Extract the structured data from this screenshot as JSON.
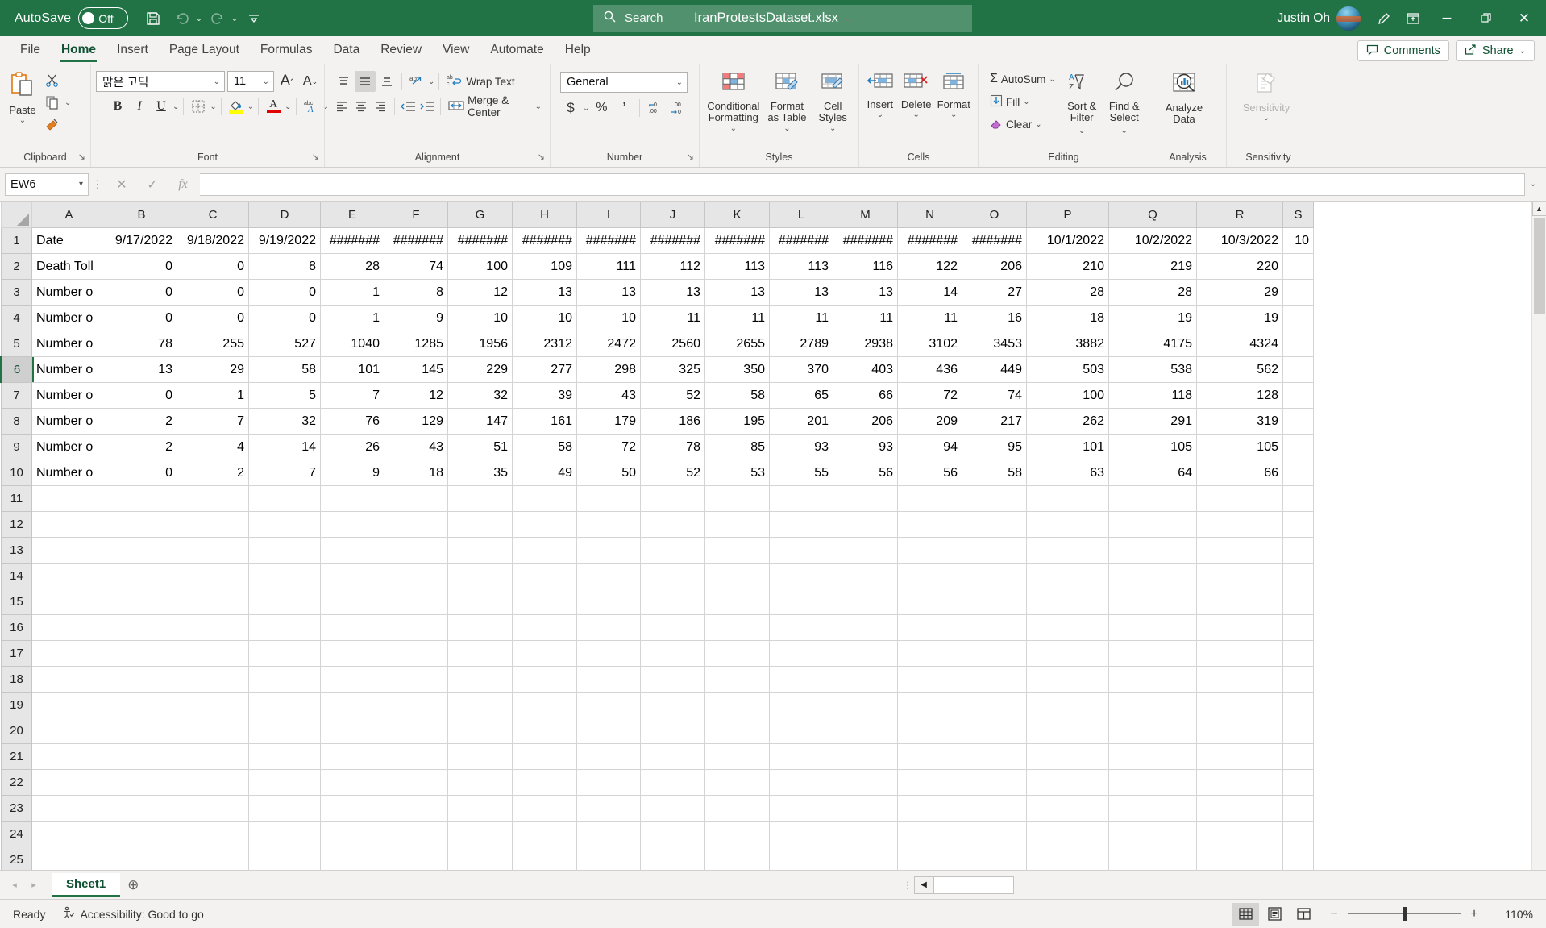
{
  "titlebar": {
    "autosave_label": "AutoSave",
    "autosave_state": "Off",
    "save_icon": "save-icon",
    "undo_icon": "undo-icon",
    "redo_icon": "redo-icon",
    "customize_icon": "customize-quick-access-icon",
    "document_title": "IranProtestsDataset.xlsx",
    "title_chevron": "⌄",
    "search_placeholder": "Search",
    "search_icon": "search-icon",
    "username": "Justin Oh",
    "avatar": "user-avatar",
    "pen_icon": "draw-pen-icon",
    "ribbon_display_icon": "ribbon-display-options-icon",
    "minimize_icon": "─",
    "restore_icon": "❐",
    "close_icon": "✕"
  },
  "tabs": [
    {
      "label": "File",
      "active": false
    },
    {
      "label": "Home",
      "active": true
    },
    {
      "label": "Insert",
      "active": false
    },
    {
      "label": "Page Layout",
      "active": false
    },
    {
      "label": "Formulas",
      "active": false
    },
    {
      "label": "Data",
      "active": false
    },
    {
      "label": "Review",
      "active": false
    },
    {
      "label": "View",
      "active": false
    },
    {
      "label": "Automate",
      "active": false
    },
    {
      "label": "Help",
      "active": false
    }
  ],
  "tab_right": {
    "comments_label": "Comments",
    "comments_icon": "comment-icon",
    "share_label": "Share",
    "share_icon": "share-icon",
    "share_chevron": "⌄"
  },
  "ribbon": {
    "clipboard": {
      "group_label": "Clipboard",
      "dialog_launcher": "↘",
      "paste_label": "Paste",
      "paste_chevron": "⌄",
      "cut_icon": "cut-scissors-icon",
      "copy_icon": "copy-icon",
      "copy_chevron": "⌄",
      "format_painter_icon": "format-painter-icon"
    },
    "font": {
      "group_label": "Font",
      "dialog_launcher": "↘",
      "font_name": "맑은 고딕",
      "font_size": "11",
      "grow_font_label": "A",
      "shrink_font_label": "A",
      "bold_label": "B",
      "italic_label": "I",
      "underline_label": "U",
      "borders_icon": "borders-icon",
      "fill_color_icon": "fill-color-icon",
      "font_color_icon": "font-color-icon",
      "phonetic_icon": "phonetic-guide-icon",
      "chevron": "⌄"
    },
    "alignment": {
      "group_label": "Alignment",
      "dialog_launcher": "↘",
      "align_top_icon": "align-top-icon",
      "align_middle_icon": "align-middle-icon",
      "align_bottom_icon": "align-bottom-icon",
      "orientation_icon": "text-orientation-icon",
      "wrap_text_label": "Wrap Text",
      "wrap_text_icon": "wrap-text-icon",
      "align_left_icon": "align-left-icon",
      "align_center_icon": "align-center-icon",
      "align_right_icon": "align-right-icon",
      "decrease_indent_icon": "decrease-indent-icon",
      "increase_indent_icon": "increase-indent-icon",
      "merge_center_label": "Merge & Center",
      "merge_center_icon": "merge-center-icon",
      "chevron": "⌄"
    },
    "number": {
      "group_label": "Number",
      "dialog_launcher": "↘",
      "format_value": "General",
      "currency_label": "$",
      "percent_label": "%",
      "comma_label": "’",
      "increase_decimal_icon": "increase-decimal-icon",
      "decrease_decimal_icon": "decrease-decimal-icon",
      "chevron": "⌄"
    },
    "styles": {
      "group_label": "Styles",
      "conditional_formatting_label": "Conditional Formatting",
      "conditional_formatting_icon": "conditional-formatting-icon",
      "format_as_table_label": "Format as Table",
      "format_as_table_icon": "format-as-table-icon",
      "cell_styles_label": "Cell Styles",
      "cell_styles_icon": "cell-styles-icon",
      "chevron": "⌄"
    },
    "cells": {
      "group_label": "Cells",
      "insert_label": "Insert",
      "insert_icon": "insert-cells-icon",
      "delete_label": "Delete",
      "delete_icon": "delete-cells-icon",
      "format_label": "Format",
      "format_icon": "format-cells-icon",
      "chevron": "⌄"
    },
    "editing": {
      "group_label": "Editing",
      "autosum_label": "AutoSum",
      "autosum_icon": "sigma-icon",
      "fill_label": "Fill",
      "fill_icon": "fill-down-icon",
      "clear_label": "Clear",
      "clear_icon": "eraser-icon",
      "sort_filter_label": "Sort & Filter",
      "sort_filter_icon": "sort-filter-icon",
      "find_select_label": "Find & Select",
      "find_select_icon": "magnifier-icon",
      "chevron": "⌄"
    },
    "analysis": {
      "group_label": "Analysis",
      "analyze_data_label": "Analyze Data",
      "analyze_data_icon": "analyze-data-icon"
    },
    "sensitivity": {
      "group_label": "Sensitivity",
      "sensitivity_label": "Sensitivity",
      "sensitivity_icon": "sensitivity-label-icon",
      "chevron": "⌄"
    }
  },
  "formula_bar": {
    "name_box_value": "EW6",
    "name_box_chevron": "▾",
    "cancel_icon": "✕",
    "enter_icon": "✓",
    "function_icon": "fx",
    "formula_value": "",
    "expand_icon": "⌄"
  },
  "grid": {
    "column_headers": [
      "A",
      "B",
      "C",
      "D",
      "E",
      "F",
      "G",
      "H",
      "I",
      "J",
      "K",
      "L",
      "M",
      "N",
      "O",
      "P",
      "Q",
      "R",
      "S"
    ],
    "row_headers": [
      "1",
      "2",
      "3",
      "4",
      "5",
      "6",
      "7",
      "8",
      "9",
      "10",
      "11",
      "12",
      "13",
      "14",
      "15",
      "16",
      "17",
      "18",
      "19",
      "20",
      "21",
      "22",
      "23",
      "24",
      "25"
    ],
    "active_row": "6",
    "active_col": "A",
    "rows": [
      [
        "Date",
        "9/17/2022",
        "9/18/2022",
        "9/19/2022",
        "#######",
        "#######",
        "#######",
        "#######",
        "#######",
        "#######",
        "#######",
        "#######",
        "#######",
        "#######",
        "#######",
        "10/1/2022",
        "10/2/2022",
        "10/3/2022",
        "10"
      ],
      [
        "Death Toll",
        "0",
        "0",
        "8",
        "28",
        "74",
        "100",
        "109",
        "111",
        "112",
        "113",
        "113",
        "116",
        "122",
        "206",
        "210",
        "219",
        "220",
        ""
      ],
      [
        "Number o",
        "0",
        "0",
        "0",
        "1",
        "8",
        "12",
        "13",
        "13",
        "13",
        "13",
        "13",
        "13",
        "14",
        "27",
        "28",
        "28",
        "29",
        ""
      ],
      [
        "Number o",
        "0",
        "0",
        "0",
        "1",
        "9",
        "10",
        "10",
        "10",
        "11",
        "11",
        "11",
        "11",
        "11",
        "16",
        "18",
        "19",
        "19",
        ""
      ],
      [
        "Number o",
        "78",
        "255",
        "527",
        "1040",
        "1285",
        "1956",
        "2312",
        "2472",
        "2560",
        "2655",
        "2789",
        "2938",
        "3102",
        "3453",
        "3882",
        "4175",
        "4324",
        ""
      ],
      [
        "Number o",
        "13",
        "29",
        "58",
        "101",
        "145",
        "229",
        "277",
        "298",
        "325",
        "350",
        "370",
        "403",
        "436",
        "449",
        "503",
        "538",
        "562",
        ""
      ],
      [
        "Number o",
        "0",
        "1",
        "5",
        "7",
        "12",
        "32",
        "39",
        "43",
        "52",
        "58",
        "65",
        "66",
        "72",
        "74",
        "100",
        "118",
        "128",
        ""
      ],
      [
        "Number o",
        "2",
        "7",
        "32",
        "76",
        "129",
        "147",
        "161",
        "179",
        "186",
        "195",
        "201",
        "206",
        "209",
        "217",
        "262",
        "291",
        "319",
        ""
      ],
      [
        "Number o",
        "2",
        "4",
        "14",
        "26",
        "43",
        "51",
        "58",
        "72",
        "78",
        "85",
        "93",
        "93",
        "94",
        "95",
        "101",
        "105",
        "105",
        ""
      ],
      [
        "Number o",
        "0",
        "2",
        "7",
        "9",
        "18",
        "35",
        "49",
        "50",
        "52",
        "53",
        "55",
        "56",
        "56",
        "58",
        "63",
        "64",
        "66",
        ""
      ]
    ]
  },
  "sheetbar": {
    "prev_icon": "◂",
    "next_icon": "▸",
    "sheets": [
      {
        "label": "Sheet1",
        "active": true
      }
    ],
    "add_sheet_icon": "⊕",
    "hscroll_left_icon": "◀"
  },
  "statusbar": {
    "mode": "Ready",
    "accessibility_icon": "accessibility-icon",
    "accessibility": "Accessibility: Good to go",
    "view_normal_icon": "normal-view-icon",
    "view_pagelayout_icon": "page-layout-view-icon",
    "view_pagebreak_icon": "page-break-preview-icon",
    "zoom_out": "−",
    "zoom_in": "+",
    "zoom_level": "110%"
  },
  "colors": {
    "brand_green": "#217346",
    "ribbon_bg": "#f3f2f1",
    "grid_line": "#d4d4d4",
    "header_bg": "#e6e6e6"
  }
}
